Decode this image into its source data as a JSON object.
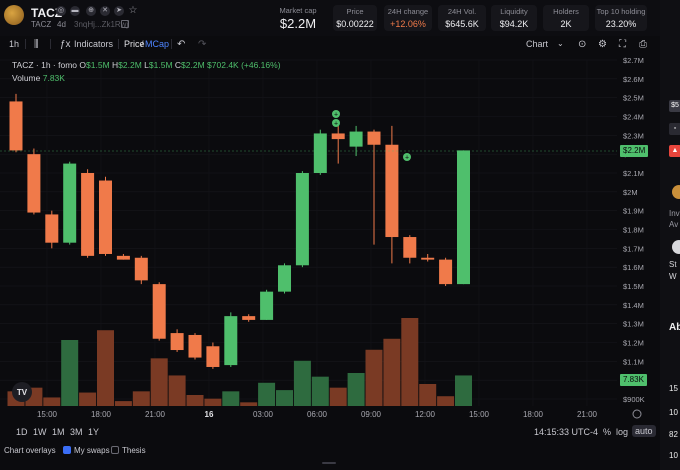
{
  "token": {
    "name": "TACZ",
    "ticker": "TACZ",
    "age": "4d",
    "address": "3nqHj...Zk1Rwj",
    "icons": [
      "globe-icon",
      "x-icon",
      "telegram-icon",
      "star-icon"
    ]
  },
  "stats": {
    "market_cap": {
      "label": "Market cap",
      "value": "$2.2M"
    },
    "price": {
      "label": "Price",
      "value": "$0.00222"
    },
    "change_24h": {
      "label": "24H change",
      "value": "+12.06%"
    },
    "volume_24h": {
      "label": "24H Vol.",
      "value": "$645.6K"
    },
    "liquidity": {
      "label": "Liquidity",
      "value": "$94.2K"
    },
    "holders": {
      "label": "Holders",
      "value": "2K"
    },
    "top10": {
      "label": "Top 10 holding",
      "value": "23.20%"
    }
  },
  "toolbar": {
    "interval": "1h",
    "indicators": "Indicators",
    "price_label": "Price",
    "mcap_label": "MCap",
    "chart_label": "Chart"
  },
  "legend": {
    "title": "TACZ · 1h · fomo",
    "o_label": "O",
    "o": "$1.5M",
    "h_label": "H",
    "h": "$2.2M",
    "l_label": "L",
    "l": "$1.5M",
    "c_label": "C",
    "c": "$2.2M",
    "change": "$702.4K (+46.16%)",
    "volume_label": "Volume",
    "volume": "7.83K"
  },
  "price_tags": {
    "last_price": "$2.2M",
    "last_volume": "7.83K"
  },
  "colors": {
    "up": "#4fbf6c",
    "down": "#f07a4a",
    "up_vol": "#2e6b3f",
    "down_vol": "#7a3a24",
    "bg": "#0b0b0e"
  },
  "chart_data": {
    "type": "candlestick",
    "y_axis": {
      "unit": "USD market cap",
      "ticks": [
        "$2.7M",
        "$2.6M",
        "$2.5M",
        "$2.4M",
        "$2.3M",
        "$2.2M",
        "$2.1M",
        "$2M",
        "$1.9M",
        "$1.8M",
        "$1.7M",
        "$1.6M",
        "$1.5M",
        "$1.4M",
        "$1.3M",
        "$1.2M",
        "$1.1M",
        "$1M",
        "$900K"
      ],
      "range": [
        0.9,
        2.7
      ]
    },
    "x_axis": {
      "ticks": [
        "15:00",
        "18:00",
        "21:00",
        "16",
        "03:00",
        "06:00",
        "09:00",
        "12:00",
        "15:00",
        "18:00",
        "21:00"
      ]
    },
    "candles": [
      {
        "o": 2.48,
        "h": 2.52,
        "l": 2.21,
        "c": 2.22,
        "v": 0.12
      },
      {
        "o": 2.2,
        "h": 2.23,
        "l": 1.88,
        "c": 1.89,
        "v": 0.15
      },
      {
        "o": 1.88,
        "h": 1.9,
        "l": 1.7,
        "c": 1.73,
        "v": 0.07
      },
      {
        "o": 1.73,
        "h": 2.16,
        "l": 1.72,
        "c": 2.15,
        "v": 0.54
      },
      {
        "o": 2.1,
        "h": 2.12,
        "l": 1.65,
        "c": 1.66,
        "v": 0.11
      },
      {
        "o": 2.06,
        "h": 2.08,
        "l": 1.66,
        "c": 1.67,
        "v": 0.62
      },
      {
        "o": 1.66,
        "h": 1.67,
        "l": 1.64,
        "c": 1.64,
        "v": 0.04
      },
      {
        "o": 1.65,
        "h": 1.66,
        "l": 1.51,
        "c": 1.53,
        "v": 0.12
      },
      {
        "o": 1.51,
        "h": 1.52,
        "l": 1.21,
        "c": 1.22,
        "v": 0.39
      },
      {
        "o": 1.25,
        "h": 1.27,
        "l": 1.15,
        "c": 1.16,
        "v": 0.25
      },
      {
        "o": 1.24,
        "h": 1.25,
        "l": 1.11,
        "c": 1.12,
        "v": 0.09
      },
      {
        "o": 1.18,
        "h": 1.2,
        "l": 1.06,
        "c": 1.07,
        "v": 0.06
      },
      {
        "o": 1.08,
        "h": 1.36,
        "l": 1.07,
        "c": 1.34,
        "v": 0.12
      },
      {
        "o": 1.34,
        "h": 1.35,
        "l": 1.31,
        "c": 1.32,
        "v": 0.03
      },
      {
        "o": 1.32,
        "h": 1.48,
        "l": 1.32,
        "c": 1.47,
        "v": 0.19
      },
      {
        "o": 1.47,
        "h": 1.62,
        "l": 1.46,
        "c": 1.61,
        "v": 0.13
      },
      {
        "o": 1.61,
        "h": 2.11,
        "l": 1.6,
        "c": 2.1,
        "v": 0.37
      },
      {
        "o": 2.1,
        "h": 2.33,
        "l": 2.09,
        "c": 2.31,
        "v": 0.24
      },
      {
        "o": 2.31,
        "h": 2.36,
        "l": 2.15,
        "c": 2.28,
        "v": 0.15
      },
      {
        "o": 2.24,
        "h": 2.35,
        "l": 2.19,
        "c": 2.32,
        "v": 0.27
      },
      {
        "o": 2.32,
        "h": 2.33,
        "l": 1.72,
        "c": 2.25,
        "v": 0.46
      },
      {
        "o": 2.25,
        "h": 2.35,
        "l": 1.62,
        "c": 1.76,
        "v": 0.55
      },
      {
        "o": 1.76,
        "h": 1.77,
        "l": 1.62,
        "c": 1.65,
        "v": 0.72
      },
      {
        "o": 1.65,
        "h": 1.67,
        "l": 1.63,
        "c": 1.64,
        "v": 0.18
      },
      {
        "o": 1.64,
        "h": 1.65,
        "l": 1.5,
        "c": 1.51,
        "v": 0.08
      },
      {
        "o": 1.51,
        "h": 2.22,
        "l": 1.51,
        "c": 2.22,
        "v": 0.25
      }
    ],
    "grid": true
  },
  "bottombar": {
    "ranges": [
      "1D",
      "1W",
      "1M",
      "3M",
      "1Y"
    ],
    "clock": "14:15:33 UTC-4",
    "percent": "%",
    "log": "log",
    "auto": "auto"
  },
  "overlays": {
    "title": "Chart overlays",
    "my_swaps": "My swaps",
    "thesis": "Thesis"
  },
  "right_panel": {
    "items": [
      "$5",
      "Inv",
      "Av",
      "St",
      "W",
      "Ab",
      "15",
      "10",
      "82",
      "10"
    ]
  }
}
